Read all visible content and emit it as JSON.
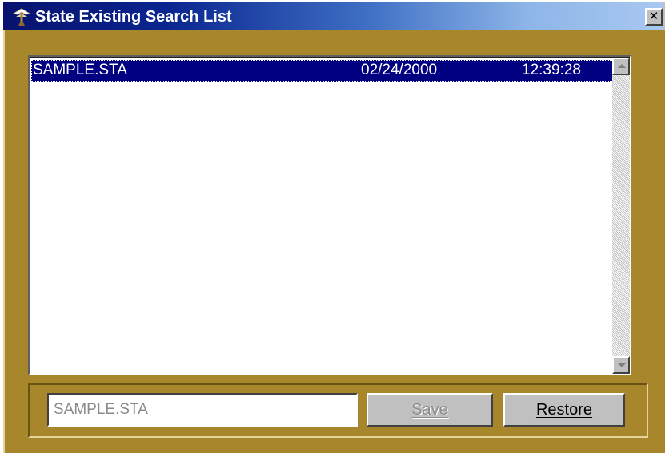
{
  "window": {
    "title": "State Existing Search List",
    "close_label": "✕"
  },
  "list": {
    "rows": [
      {
        "name": "SAMPLE.STA",
        "date": "02/24/2000",
        "time": "12:39:28",
        "selected": true
      }
    ]
  },
  "bottom": {
    "filename_value": "SAMPLE.STA",
    "save_label": "Save",
    "restore_label": "Restore"
  },
  "colors": {
    "frame": "#a8862c",
    "selection": "#000080",
    "title_start": "#08126e",
    "title_end": "#a8c8f0"
  },
  "icons": {
    "app": "search-tree-icon",
    "close": "close-icon"
  }
}
